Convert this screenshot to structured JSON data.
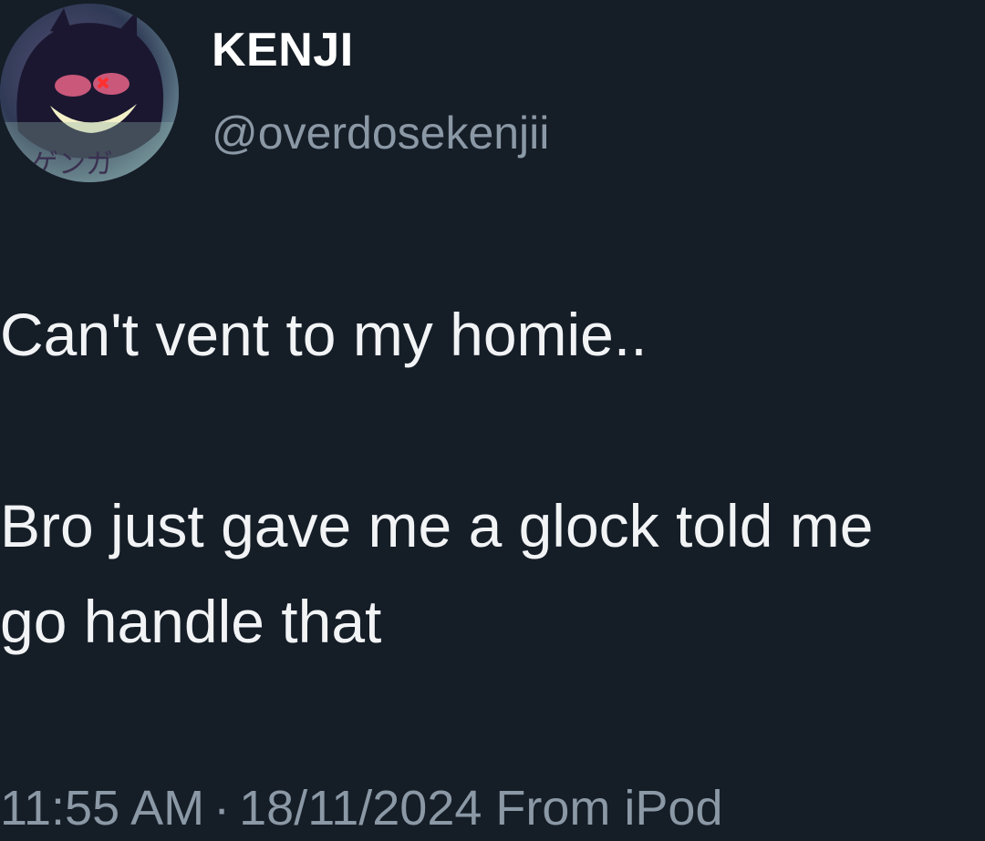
{
  "author": {
    "display_name": "KENJI",
    "handle": "@overdosekenjii",
    "avatar_icon": "gengar-avatar",
    "avatar_text": "ゲンガ"
  },
  "tweet": {
    "line1": "Can't vent to my homie..",
    "line2": "Bro just gave me a glock told me",
    "line3": "go handle that"
  },
  "meta": {
    "time": "11:55 AM",
    "separator": "·",
    "date": "18/11/2024",
    "source": "From iPod"
  },
  "colors": {
    "background": "#151d27",
    "primary_text": "#f1f3f5",
    "secondary_text": "#8b98a5"
  }
}
